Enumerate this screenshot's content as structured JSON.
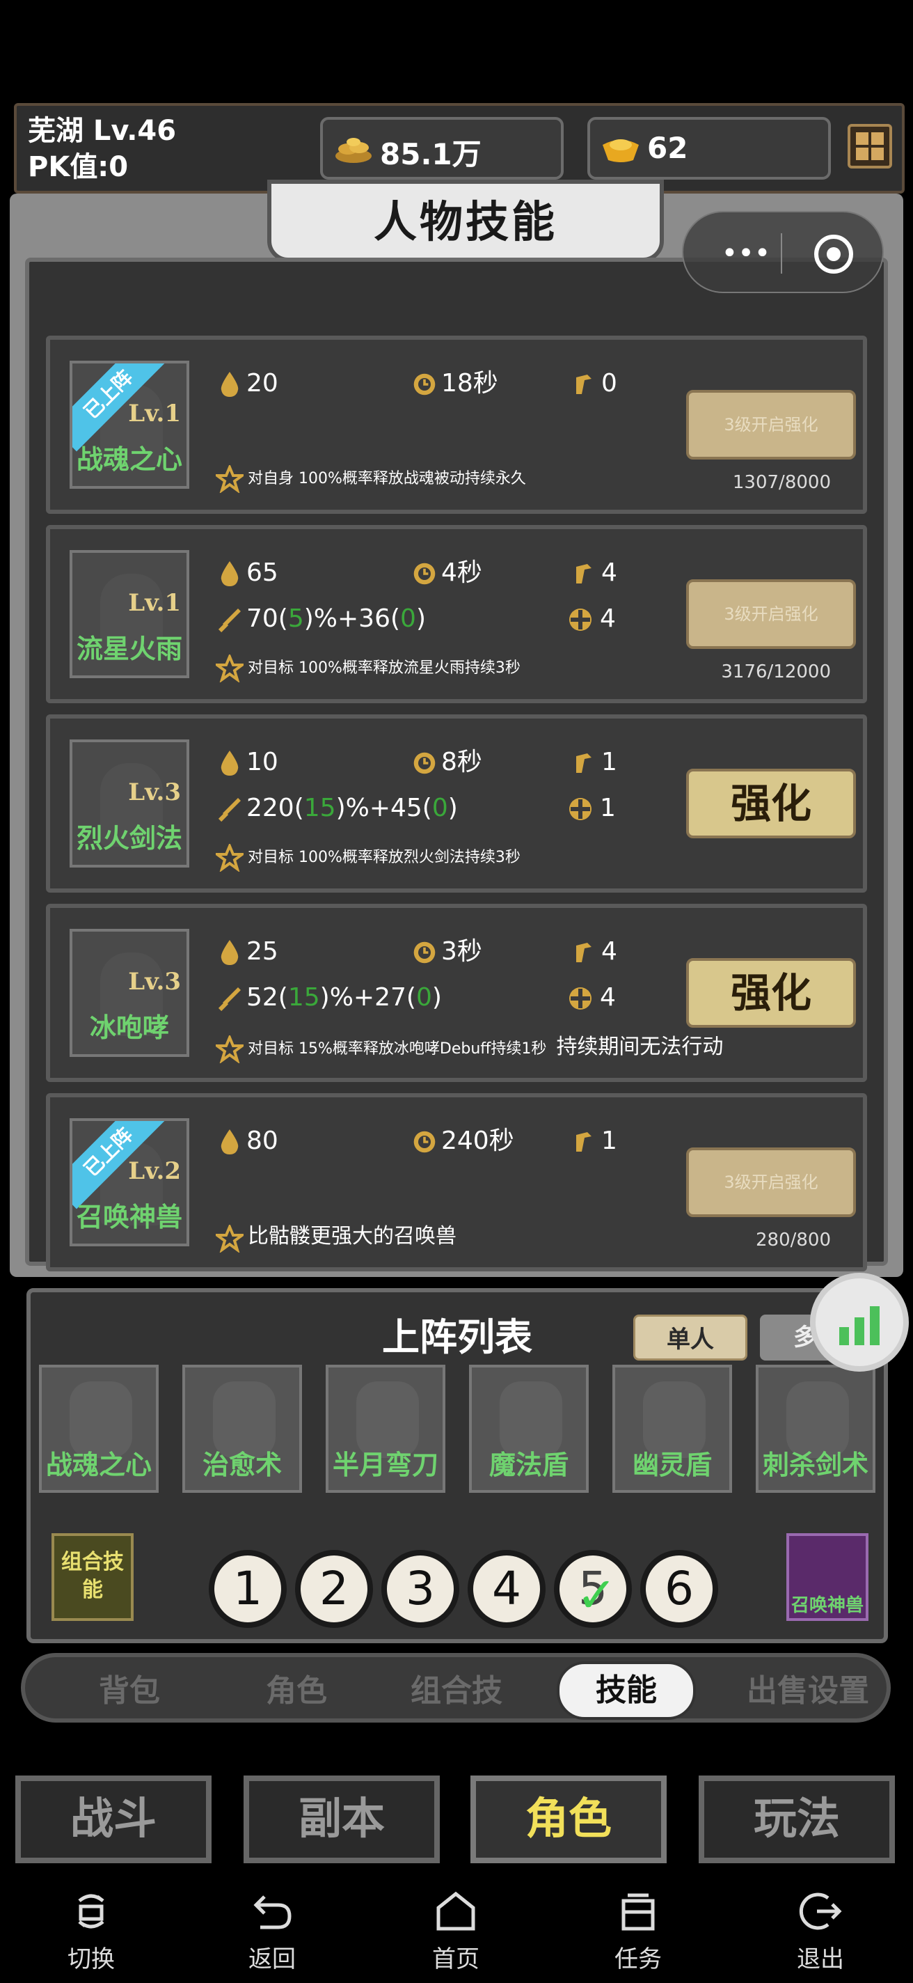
{
  "header": {
    "player_line1": "芜湖 Lv.46",
    "player_line2": "PK值:0",
    "coins": "85.1万",
    "gold": "62",
    "coin_icon": "coin-pile-icon",
    "gold_icon": "gold-ingot-icon",
    "menu_icon": "grid-menu-icon"
  },
  "panel": {
    "title": "人物技能"
  },
  "miniprogram": {
    "more_icon": "•••",
    "close_icon": "record-target-icon"
  },
  "skills": [
    {
      "ribbon": "已上阵",
      "level": "Lv.1",
      "name": "战魂之心",
      "mp": "20",
      "cooldown": "18秒",
      "range": "0",
      "damage_pre": "",
      "damage_a": "",
      "damage_mid": "",
      "damage_b": "",
      "damage_post": "",
      "targets": "",
      "desc": "对自身 100%概率释放战魂被动持续永久",
      "desc_extra": "",
      "button": "3级开启强化",
      "progress": "1307/8000"
    },
    {
      "ribbon": "",
      "level": "Lv.1",
      "name": "流星火雨",
      "mp": "65",
      "cooldown": "4秒",
      "range": "4",
      "damage_pre": "70(",
      "damage_a": "5",
      "damage_mid": ")%+36(",
      "damage_b": "0",
      "damage_post": ")",
      "targets": "4",
      "desc": "对目标 100%概率释放流星火雨持续3秒",
      "desc_extra": "",
      "button": "3级开启强化",
      "progress": "3176/12000"
    },
    {
      "ribbon": "",
      "level": "Lv.3",
      "name": "烈火剑法",
      "mp": "10",
      "cooldown": "8秒",
      "range": "1",
      "damage_pre": "220(",
      "damage_a": "15",
      "damage_mid": ")%+45(",
      "damage_b": "0",
      "damage_post": ")",
      "targets": "1",
      "desc": "对目标 100%概率释放烈火剑法持续3秒",
      "desc_extra": "",
      "button": "强化",
      "progress": ""
    },
    {
      "ribbon": "",
      "level": "Lv.3",
      "name": "冰咆哮",
      "mp": "25",
      "cooldown": "3秒",
      "range": "4",
      "damage_pre": "52(",
      "damage_a": "15",
      "damage_mid": ")%+27(",
      "damage_b": "0",
      "damage_post": ")",
      "targets": "4",
      "desc": "对目标 15%概率释放冰咆哮Debuff持续1秒",
      "desc_extra": "持续期间无法行动",
      "button": "强化",
      "progress": ""
    },
    {
      "ribbon": "已上阵",
      "level": "Lv.2",
      "name": "召唤神兽",
      "mp": "80",
      "cooldown": "240秒",
      "range": "1",
      "damage_pre": "",
      "damage_a": "",
      "damage_mid": "",
      "damage_b": "",
      "damage_post": "",
      "targets": "",
      "desc": "比骷髅更强大的召唤兽",
      "desc_extra": "",
      "button": "3级开启强化",
      "progress": "280/800"
    }
  ],
  "lineup": {
    "title": "上阵列表",
    "tab_single": "单人",
    "tab_multi": "多人",
    "skills": [
      "战魂之心",
      "治愈术",
      "半月弯刀",
      "魔法盾",
      "幽灵盾",
      "刺杀剑术"
    ],
    "combo": "组合技能",
    "slots": [
      "1",
      "2",
      "3",
      "4",
      "5",
      "6"
    ],
    "selected_slot": "5",
    "pet": "召唤神兽"
  },
  "subtabs": [
    "背包",
    "角色",
    "组合技",
    "技能",
    "出售设置"
  ],
  "subtab_active": "技能",
  "main_tabs": [
    "战斗",
    "副本",
    "角色",
    "玩法"
  ],
  "main_tab_active": "角色",
  "nav": [
    "切换",
    "返回",
    "首页",
    "任务",
    "退出"
  ],
  "colors": {
    "green_text": "#6fd36f",
    "gold_text": "#f2e05a",
    "ribbon": "#4fc3e8"
  }
}
